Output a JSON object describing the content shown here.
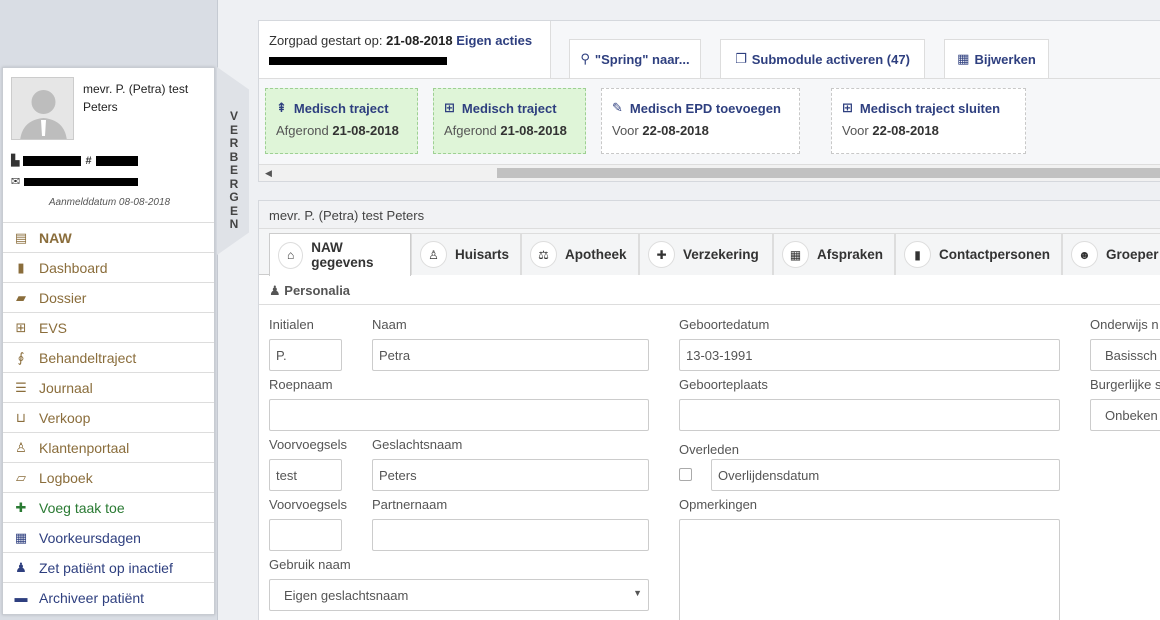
{
  "patient": {
    "name_line1": "mevr. P. (Petra) test",
    "name_line2": "Peters",
    "id_prefix": "#",
    "registration": "Aanmelddatum 08-08-2018"
  },
  "hide_label": [
    "V",
    "E",
    "R",
    "B",
    "E",
    "R",
    "G",
    "E",
    "N"
  ],
  "menu": [
    {
      "label": "NAW",
      "icon": "id-card-icon"
    },
    {
      "label": "Dashboard",
      "icon": "bookmark-icon"
    },
    {
      "label": "Dossier",
      "icon": "folder-icon"
    },
    {
      "label": "EVS",
      "icon": "medkit-icon"
    },
    {
      "label": "Behandeltraject",
      "icon": "stethoscope-icon"
    },
    {
      "label": "Journaal",
      "icon": "list-icon"
    },
    {
      "label": "Verkoop",
      "icon": "basket-icon"
    },
    {
      "label": "Klantenportaal",
      "icon": "user-icon"
    },
    {
      "label": "Logboek",
      "icon": "book-icon"
    },
    {
      "label": "Voeg taak toe",
      "icon": "plus-icon"
    },
    {
      "label": "Voorkeursdagen",
      "icon": "calendar-icon"
    },
    {
      "label": "Zet patiënt op inactief",
      "icon": "user-times-icon"
    },
    {
      "label": "Archiveer patiënt",
      "icon": "archive-icon"
    }
  ],
  "zorgpad": {
    "started_label": "Zorgpad gestart op:",
    "started_date": "21-08-2018",
    "actions_link": "Eigen acties"
  },
  "toolbar": {
    "spring": "\"Spring\" naar...",
    "submodule": "Submodule activeren (47)",
    "bijwerken": "Bijwerken"
  },
  "cards": [
    {
      "title": "Medisch traject",
      "sub_label": "Afgerond",
      "date": "21-08-2018",
      "icon": "signpost-icon"
    },
    {
      "title": "Medisch traject",
      "sub_label": "Afgerond",
      "date": "21-08-2018",
      "icon": "medkit-icon"
    },
    {
      "title": "Medisch EPD toevoegen",
      "sub_label": "Voor",
      "date": "22-08-2018",
      "icon": "pencil-icon"
    },
    {
      "title": "Medisch traject sluiten",
      "sub_label": "Voor",
      "date": "22-08-2018",
      "icon": "medkit-icon"
    }
  ],
  "main": {
    "header": "mevr. P. (Petra) test Peters",
    "tabs": [
      {
        "label": "NAW gegevens",
        "icon": "home-icon"
      },
      {
        "label": "Huisarts",
        "icon": "user-md-icon"
      },
      {
        "label": "Apotheek",
        "icon": "scale-icon"
      },
      {
        "label": "Verzekering",
        "icon": "plus-square-icon"
      },
      {
        "label": "Afspraken",
        "icon": "calendar-icon"
      },
      {
        "label": "Contactpersonen",
        "icon": "contact-book-icon"
      },
      {
        "label": "Groeper",
        "icon": "users-icon"
      }
    ],
    "section": "Personalia"
  },
  "form": {
    "initialen_label": "Initialen",
    "initialen": "P.",
    "naam_label": "Naam",
    "naam": "Petra",
    "roepnaam_label": "Roepnaam",
    "roepnaam": "",
    "voorvoegsels_label": "Voorvoegsels",
    "voorvoegsels": "test",
    "geslachtsnaam_label": "Geslachtsnaam",
    "geslachtsnaam": "Peters",
    "voorvoegsels2_label": "Voorvoegsels",
    "voorvoegsels2": "",
    "partnernaam_label": "Partnernaam",
    "partnernaam": "",
    "gebruik_naam_label": "Gebruik naam",
    "gebruik_naam": "Eigen geslachtsnaam",
    "geboortedatum_label": "Geboortedatum",
    "geboortedatum": "13-03-1991",
    "geboorteplaats_label": "Geboorteplaats",
    "geboorteplaats": "",
    "overleden_label": "Overleden",
    "overlijdensdatum_placeholder": "Overlijdensdatum",
    "opmerkingen_label": "Opmerkingen",
    "opmerkingen": "",
    "onderwijs_label": "Onderwijs n",
    "onderwijs": "Basissch",
    "burgerlijke_label": "Burgerlijke s",
    "burgerlijke": "Onbeken"
  }
}
